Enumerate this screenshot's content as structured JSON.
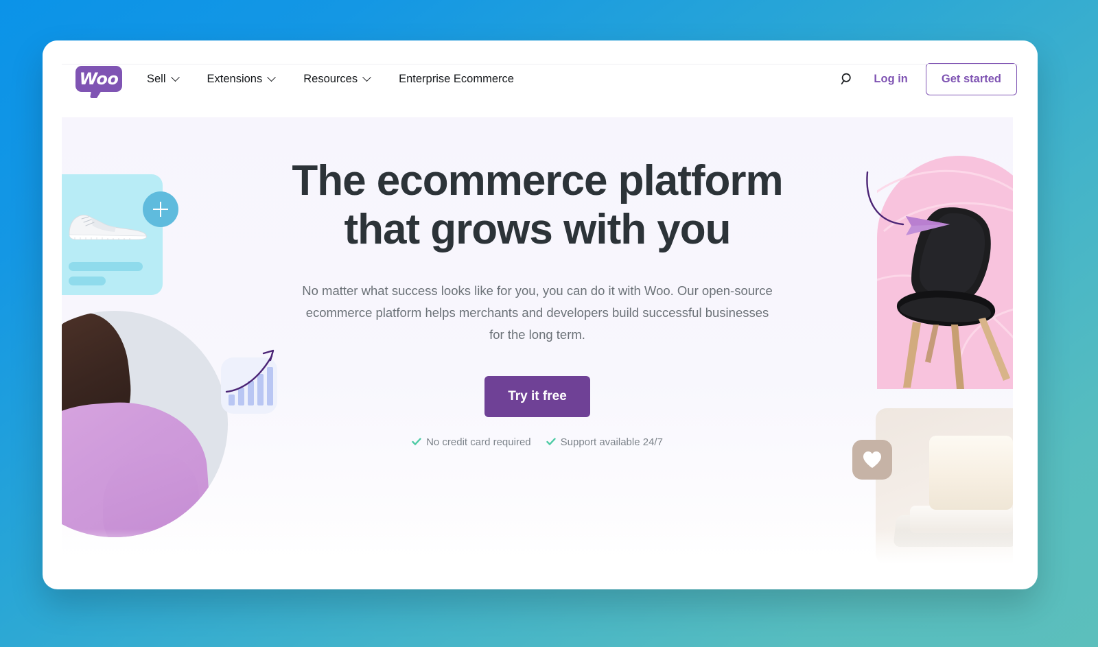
{
  "brand": {
    "logo_text": "Woo",
    "logo_color": "#7f54b3"
  },
  "nav": {
    "items": [
      {
        "label": "Sell",
        "has_dropdown": true
      },
      {
        "label": "Extensions",
        "has_dropdown": true
      },
      {
        "label": "Resources",
        "has_dropdown": true
      },
      {
        "label": "Enterprise Ecommerce",
        "has_dropdown": false
      }
    ],
    "search_icon": "search-icon",
    "login_label": "Log in",
    "get_started_label": "Get started"
  },
  "hero": {
    "headline_line_1": "The ecommerce platform",
    "headline_line_2": "that grows with you",
    "subheadline": "No matter what success looks like for you, you can do it with Woo. Our open-source ecommerce platform helps merchants and developers build successful businesses for the long term.",
    "cta_label": "Try it free",
    "badges": [
      {
        "icon": "check-icon",
        "label": "No credit card required"
      },
      {
        "icon": "check-icon",
        "label": "Support available 24/7"
      }
    ],
    "background_color": "#f7f5fd"
  },
  "illustrations": {
    "shoe_card": {
      "name": "sneaker-product-card",
      "card_color": "#b8ecf6",
      "add_button_icon": "plus-icon",
      "add_button_color": "#5fbbdd"
    },
    "person_circle": {
      "name": "person-in-lavender-sweater",
      "circle_color": "#dfe3ea",
      "badge_icon": "growth-chart-icon",
      "badge_color": "#eef1fc"
    },
    "chair_block": {
      "name": "black-chair-on-pink-arch",
      "arch_color": "#f8c3dd",
      "accents": [
        "curved-arrow-icon",
        "paper-plane-icon"
      ]
    },
    "soap_card": {
      "name": "soap-bars-product-card",
      "badge_icon": "heart-icon",
      "badge_color": "#c6b3a6"
    }
  },
  "colors": {
    "page_gradient_start": "#0b93e8",
    "page_gradient_end": "#5cbfbc",
    "primary_purple": "#7f54b3",
    "cta_purple": "#6f4196",
    "headline": "#2c3338",
    "body_text": "#6b7177",
    "check_green": "#4ecba5"
  }
}
